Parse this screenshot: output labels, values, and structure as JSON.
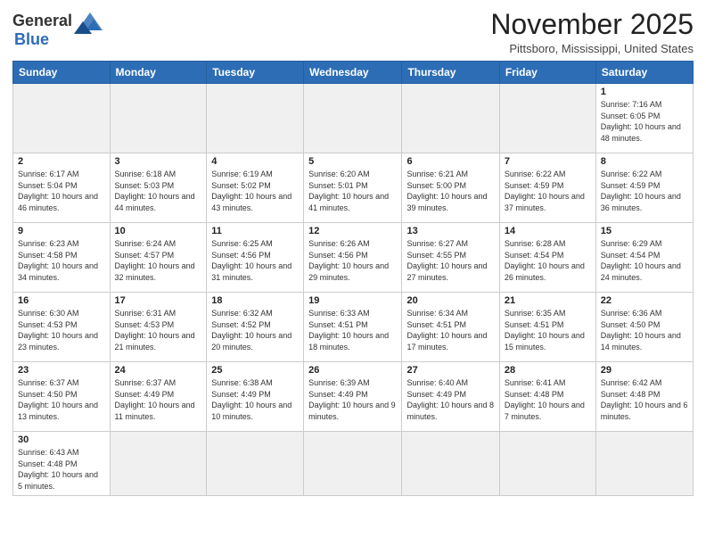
{
  "header": {
    "logo_general": "General",
    "logo_blue": "Blue",
    "month_title": "November 2025",
    "location": "Pittsboro, Mississippi, United States"
  },
  "weekdays": [
    "Sunday",
    "Monday",
    "Tuesday",
    "Wednesday",
    "Thursday",
    "Friday",
    "Saturday"
  ],
  "weeks": [
    [
      {
        "day": "",
        "info": ""
      },
      {
        "day": "",
        "info": ""
      },
      {
        "day": "",
        "info": ""
      },
      {
        "day": "",
        "info": ""
      },
      {
        "day": "",
        "info": ""
      },
      {
        "day": "",
        "info": ""
      },
      {
        "day": "1",
        "info": "Sunrise: 7:16 AM\nSunset: 6:05 PM\nDaylight: 10 hours and 48 minutes."
      }
    ],
    [
      {
        "day": "2",
        "info": "Sunrise: 6:17 AM\nSunset: 5:04 PM\nDaylight: 10 hours and 46 minutes."
      },
      {
        "day": "3",
        "info": "Sunrise: 6:18 AM\nSunset: 5:03 PM\nDaylight: 10 hours and 44 minutes."
      },
      {
        "day": "4",
        "info": "Sunrise: 6:19 AM\nSunset: 5:02 PM\nDaylight: 10 hours and 43 minutes."
      },
      {
        "day": "5",
        "info": "Sunrise: 6:20 AM\nSunset: 5:01 PM\nDaylight: 10 hours and 41 minutes."
      },
      {
        "day": "6",
        "info": "Sunrise: 6:21 AM\nSunset: 5:00 PM\nDaylight: 10 hours and 39 minutes."
      },
      {
        "day": "7",
        "info": "Sunrise: 6:22 AM\nSunset: 4:59 PM\nDaylight: 10 hours and 37 minutes."
      },
      {
        "day": "8",
        "info": "Sunrise: 6:22 AM\nSunset: 4:59 PM\nDaylight: 10 hours and 36 minutes."
      }
    ],
    [
      {
        "day": "9",
        "info": "Sunrise: 6:23 AM\nSunset: 4:58 PM\nDaylight: 10 hours and 34 minutes."
      },
      {
        "day": "10",
        "info": "Sunrise: 6:24 AM\nSunset: 4:57 PM\nDaylight: 10 hours and 32 minutes."
      },
      {
        "day": "11",
        "info": "Sunrise: 6:25 AM\nSunset: 4:56 PM\nDaylight: 10 hours and 31 minutes."
      },
      {
        "day": "12",
        "info": "Sunrise: 6:26 AM\nSunset: 4:56 PM\nDaylight: 10 hours and 29 minutes."
      },
      {
        "day": "13",
        "info": "Sunrise: 6:27 AM\nSunset: 4:55 PM\nDaylight: 10 hours and 27 minutes."
      },
      {
        "day": "14",
        "info": "Sunrise: 6:28 AM\nSunset: 4:54 PM\nDaylight: 10 hours and 26 minutes."
      },
      {
        "day": "15",
        "info": "Sunrise: 6:29 AM\nSunset: 4:54 PM\nDaylight: 10 hours and 24 minutes."
      }
    ],
    [
      {
        "day": "16",
        "info": "Sunrise: 6:30 AM\nSunset: 4:53 PM\nDaylight: 10 hours and 23 minutes."
      },
      {
        "day": "17",
        "info": "Sunrise: 6:31 AM\nSunset: 4:53 PM\nDaylight: 10 hours and 21 minutes."
      },
      {
        "day": "18",
        "info": "Sunrise: 6:32 AM\nSunset: 4:52 PM\nDaylight: 10 hours and 20 minutes."
      },
      {
        "day": "19",
        "info": "Sunrise: 6:33 AM\nSunset: 4:51 PM\nDaylight: 10 hours and 18 minutes."
      },
      {
        "day": "20",
        "info": "Sunrise: 6:34 AM\nSunset: 4:51 PM\nDaylight: 10 hours and 17 minutes."
      },
      {
        "day": "21",
        "info": "Sunrise: 6:35 AM\nSunset: 4:51 PM\nDaylight: 10 hours and 15 minutes."
      },
      {
        "day": "22",
        "info": "Sunrise: 6:36 AM\nSunset: 4:50 PM\nDaylight: 10 hours and 14 minutes."
      }
    ],
    [
      {
        "day": "23",
        "info": "Sunrise: 6:37 AM\nSunset: 4:50 PM\nDaylight: 10 hours and 13 minutes."
      },
      {
        "day": "24",
        "info": "Sunrise: 6:37 AM\nSunset: 4:49 PM\nDaylight: 10 hours and 11 minutes."
      },
      {
        "day": "25",
        "info": "Sunrise: 6:38 AM\nSunset: 4:49 PM\nDaylight: 10 hours and 10 minutes."
      },
      {
        "day": "26",
        "info": "Sunrise: 6:39 AM\nSunset: 4:49 PM\nDaylight: 10 hours and 9 minutes."
      },
      {
        "day": "27",
        "info": "Sunrise: 6:40 AM\nSunset: 4:49 PM\nDaylight: 10 hours and 8 minutes."
      },
      {
        "day": "28",
        "info": "Sunrise: 6:41 AM\nSunset: 4:48 PM\nDaylight: 10 hours and 7 minutes."
      },
      {
        "day": "29",
        "info": "Sunrise: 6:42 AM\nSunset: 4:48 PM\nDaylight: 10 hours and 6 minutes."
      }
    ],
    [
      {
        "day": "30",
        "info": "Sunrise: 6:43 AM\nSunset: 4:48 PM\nDaylight: 10 hours and 5 minutes."
      },
      {
        "day": "",
        "info": ""
      },
      {
        "day": "",
        "info": ""
      },
      {
        "day": "",
        "info": ""
      },
      {
        "day": "",
        "info": ""
      },
      {
        "day": "",
        "info": ""
      },
      {
        "day": "",
        "info": ""
      }
    ]
  ]
}
